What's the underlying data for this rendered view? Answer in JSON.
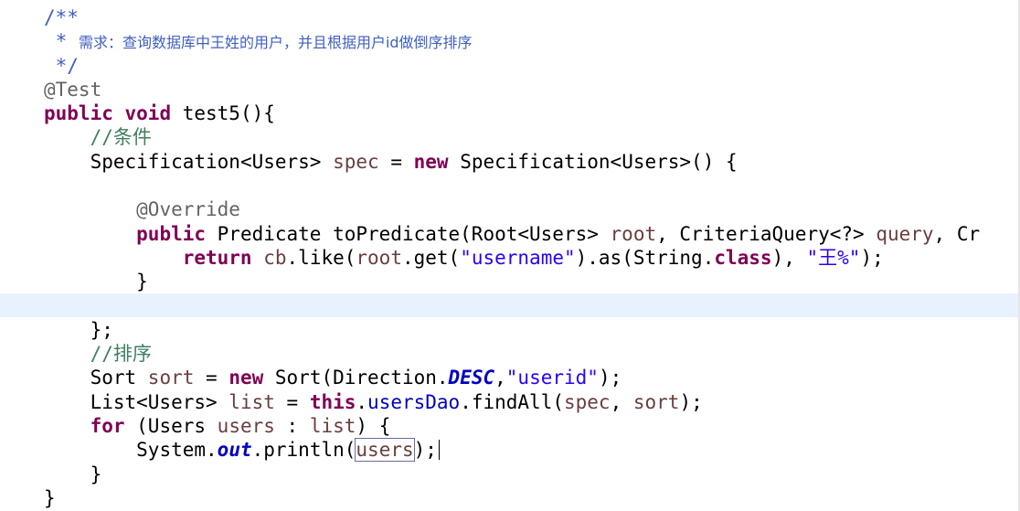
{
  "editor": {
    "lines": [
      {
        "indent": "",
        "tokens": [
          {
            "t": "/**",
            "c": "cm"
          }
        ]
      },
      {
        "indent": " ",
        "tokens": [
          {
            "t": "* ",
            "c": "cm"
          },
          {
            "t": "需求：查询数据库中王姓的用户，并且根据用户id做倒序排序",
            "c": "cm"
          }
        ]
      },
      {
        "indent": " ",
        "tokens": [
          {
            "t": "*/",
            "c": "cm"
          }
        ]
      },
      {
        "indent": "",
        "tokens": [
          {
            "t": "@Test",
            "c": "an"
          }
        ]
      },
      {
        "indent": "",
        "tokens": [
          {
            "t": "public",
            "c": "kw"
          },
          {
            "t": " ",
            "c": ""
          },
          {
            "t": "void",
            "c": "kw"
          },
          {
            "t": " test5(){",
            "c": ""
          }
        ]
      },
      {
        "indent": "    ",
        "tokens": [
          {
            "t": "//条件",
            "c": "lc"
          }
        ]
      },
      {
        "indent": "    ",
        "tokens": [
          {
            "t": "Specification<Users> ",
            "c": ""
          },
          {
            "t": "spec",
            "c": "vr"
          },
          {
            "t": " = ",
            "c": ""
          },
          {
            "t": "new",
            "c": "kw"
          },
          {
            "t": " Specification<Users>() {",
            "c": ""
          }
        ]
      },
      {
        "indent": "",
        "tokens": []
      },
      {
        "indent": "        ",
        "tokens": [
          {
            "t": "@Override",
            "c": "an"
          }
        ]
      },
      {
        "indent": "        ",
        "tokens": [
          {
            "t": "public",
            "c": "kw"
          },
          {
            "t": " Predicate toPredicate(Root<Users> ",
            "c": ""
          },
          {
            "t": "root",
            "c": "vr"
          },
          {
            "t": ", CriteriaQuery<?> ",
            "c": ""
          },
          {
            "t": "query",
            "c": "vr"
          },
          {
            "t": ", Cr",
            "c": ""
          }
        ]
      },
      {
        "indent": "            ",
        "tokens": [
          {
            "t": "return",
            "c": "kw"
          },
          {
            "t": " ",
            "c": ""
          },
          {
            "t": "cb",
            "c": "vr"
          },
          {
            "t": ".like(",
            "c": ""
          },
          {
            "t": "root",
            "c": "vr"
          },
          {
            "t": ".get(",
            "c": ""
          },
          {
            "t": "\"username\"",
            "c": "st"
          },
          {
            "t": ").as(String.",
            "c": ""
          },
          {
            "t": "class",
            "c": "kw"
          },
          {
            "t": "), ",
            "c": ""
          },
          {
            "t": "\"王%\"",
            "c": "st"
          },
          {
            "t": ");",
            "c": ""
          }
        ]
      },
      {
        "indent": "        ",
        "tokens": [
          {
            "t": "}",
            "c": ""
          }
        ]
      },
      {
        "indent": "",
        "tokens": []
      },
      {
        "indent": "    ",
        "tokens": [
          {
            "t": "};",
            "c": ""
          }
        ]
      },
      {
        "indent": "    ",
        "tokens": [
          {
            "t": "//排序",
            "c": "lc"
          }
        ]
      },
      {
        "indent": "    ",
        "tokens": [
          {
            "t": "Sort ",
            "c": ""
          },
          {
            "t": "sort",
            "c": "vr"
          },
          {
            "t": " = ",
            "c": ""
          },
          {
            "t": "new",
            "c": "kw"
          },
          {
            "t": " Sort(Direction.",
            "c": ""
          },
          {
            "t": "DESC",
            "c": "sf"
          },
          {
            "t": ",",
            "c": ""
          },
          {
            "t": "\"userid\"",
            "c": "st"
          },
          {
            "t": ");",
            "c": ""
          }
        ]
      },
      {
        "indent": "    ",
        "tokens": [
          {
            "t": "List<Users> ",
            "c": ""
          },
          {
            "t": "list",
            "c": "vr"
          },
          {
            "t": " = ",
            "c": ""
          },
          {
            "t": "this",
            "c": "kw"
          },
          {
            "t": ".",
            "c": ""
          },
          {
            "t": "usersDao",
            "c": "fd"
          },
          {
            "t": ".findAll(",
            "c": ""
          },
          {
            "t": "spec",
            "c": "vr"
          },
          {
            "t": ", ",
            "c": ""
          },
          {
            "t": "sort",
            "c": "vr"
          },
          {
            "t": ");",
            "c": ""
          }
        ]
      },
      {
        "indent": "    ",
        "tokens": [
          {
            "t": "for",
            "c": "kw"
          },
          {
            "t": " (Users ",
            "c": ""
          },
          {
            "t": "users",
            "c": "vr"
          },
          {
            "t": " : ",
            "c": ""
          },
          {
            "t": "list",
            "c": "vr"
          },
          {
            "t": ") {",
            "c": ""
          }
        ]
      },
      {
        "indent": "        ",
        "tokens": [
          {
            "t": "System.",
            "c": ""
          },
          {
            "t": "out",
            "c": "sf"
          },
          {
            "t": ".println(",
            "c": ""
          },
          {
            "t": "users",
            "c": "bx"
          },
          {
            "t": ");",
            "c": ""
          },
          {
            "t": "",
            "c": "caret"
          }
        ]
      },
      {
        "indent": "    ",
        "tokens": [
          {
            "t": "}",
            "c": ""
          }
        ]
      },
      {
        "indent": "",
        "tokens": [
          {
            "t": "}",
            "c": ""
          }
        ]
      }
    ],
    "colors": {
      "keyword": "#7f0055",
      "javadoc": "#3f5fbf",
      "line_comment": "#3f7f5f",
      "annotation": "#646464",
      "string": "#2a00ff",
      "local_variable": "#6a3e3e",
      "field": "#0000c0",
      "current_line_highlight": "#e8f2fe"
    }
  }
}
